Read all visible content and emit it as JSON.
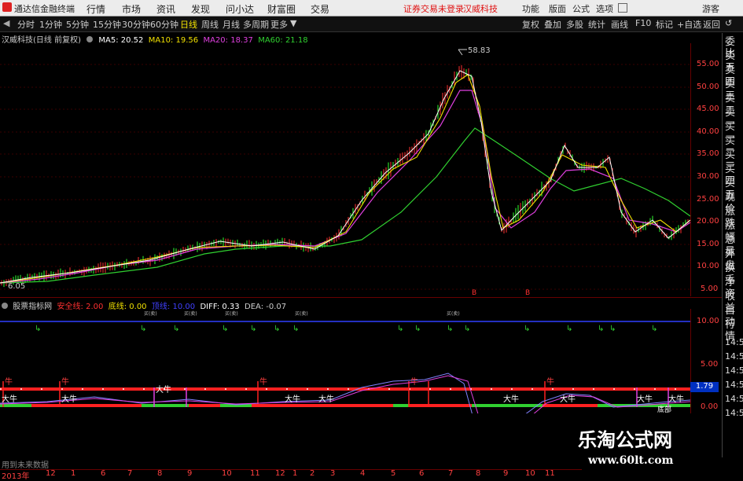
{
  "menubar": {
    "title": "通达信金融终端",
    "menus": [
      "行情",
      "市场",
      "资讯",
      "发现",
      "问小达",
      "财富圈",
      "交易"
    ],
    "notice_login": "证券交易未登录",
    "notice_stock": "汉威科技",
    "right": [
      "功能",
      "版面",
      "公式",
      "选项"
    ],
    "guest": "游客"
  },
  "tabs": [
    "分时",
    "1分钟",
    "5分钟",
    "15分钟",
    "30分钟",
    "60分钟",
    "日线",
    "周线",
    "月线",
    "多周期",
    "更多"
  ],
  "active_tab": "日线",
  "toolbar": [
    "复权",
    "叠加",
    "多股",
    "统计",
    "画线",
    "F10",
    "标记",
    "+自选",
    "返回"
  ],
  "main": {
    "stock": "汉威科技(日线 前复权)",
    "ma5": "MA5: 20.52",
    "ma10": "MA10: 19.56",
    "ma20": "MA20: 18.37",
    "ma60": "MA60: 21.18",
    "peak": "58.83",
    "low": "6.05",
    "yticks": [
      "55.00",
      "50.00",
      "45.00",
      "40.00",
      "35.00",
      "30.00",
      "25.00",
      "20.00",
      "15.00",
      "10.00",
      "5.00"
    ],
    "colors": {
      "ma5": "#ffffff",
      "ma10": "#f0e000",
      "ma20": "#e040e0",
      "ma60": "#30d030",
      "up": "#ff3030",
      "down": "#30ff30"
    }
  },
  "indicator": {
    "name": "股票指标网",
    "l1": "安全线: 2.00",
    "l2": "底线: 0.00",
    "l3": "顶线: 10.00",
    "l4": "DIFF: 0.33",
    "l5": "DEA: -0.07",
    "yticks": [
      "10.00",
      "5.00",
      "0.00"
    ],
    "signal_text": "买(卖)",
    "niu_top": "牛",
    "niu_label": "大牛",
    "right_value": "1.79",
    "bottom_label": "底部"
  },
  "rightpanel": {
    "items": [
      "委比",
      "卖五",
      "卖四",
      "卖三",
      "卖二",
      "卖一",
      "买一",
      "买二",
      "买三",
      "买四",
      "买五",
      "现价",
      "涨跌",
      "涨幅",
      "总量",
      "外盘",
      "换手",
      "净资",
      "收益",
      "自动",
      "行情"
    ],
    "times": [
      "14:50",
      "14:50",
      "14:50",
      "14:50",
      "14:50",
      "14:50",
      "14:50"
    ]
  },
  "xaxis": {
    "year": "2013年",
    "months": [
      "12",
      "1",
      "6",
      "7",
      "8",
      "9",
      "10",
      "11",
      "12",
      "1",
      "2",
      "3",
      "4",
      "5",
      "6",
      "7",
      "8",
      "9",
      "10",
      "11"
    ]
  },
  "footer": {
    "text": "用到未来数据"
  },
  "watermark": {
    "brand": "乐淘公式网",
    "url": "www.60lt.com"
  }
}
